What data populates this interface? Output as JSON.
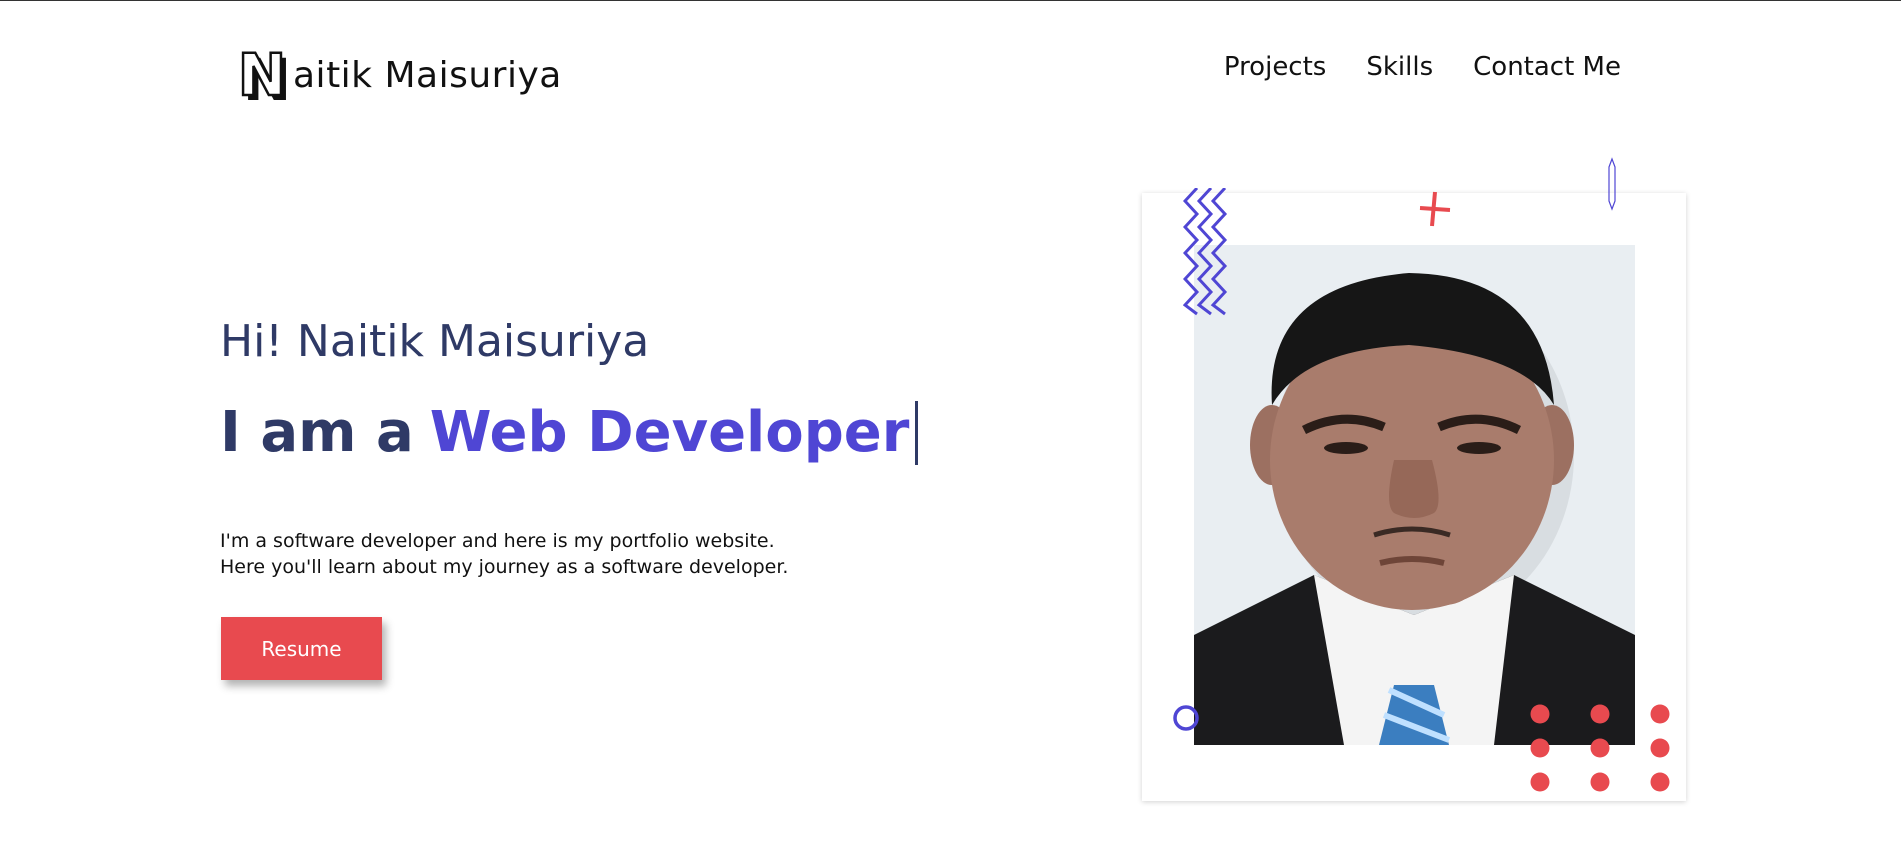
{
  "header": {
    "logo_letter": "N",
    "logo_text": "aitik Maisuriya",
    "nav": [
      "Projects",
      "Skills",
      "Contact Me"
    ]
  },
  "hero": {
    "greeting": "Hi! Naitik Maisuriya",
    "tagline_prefix": "I am a",
    "tagline_role": "Web Developer",
    "description_line1": "I'm a software developer and here is my portfolio website.",
    "description_line2": "Here you'll learn about my journey as a software developer.",
    "resume_label": "Resume"
  },
  "colors": {
    "accent_blue": "#4f46d4",
    "accent_red": "#e84a4f",
    "text_navy": "#2f3a66"
  },
  "icons": {
    "zigzag": "zigzag-decoration-icon",
    "plus": "plus-decoration-icon",
    "ring": "ring-decoration-icon",
    "dots": "dot-grid-decoration-icon",
    "pencil": "pencil-decoration-icon"
  }
}
